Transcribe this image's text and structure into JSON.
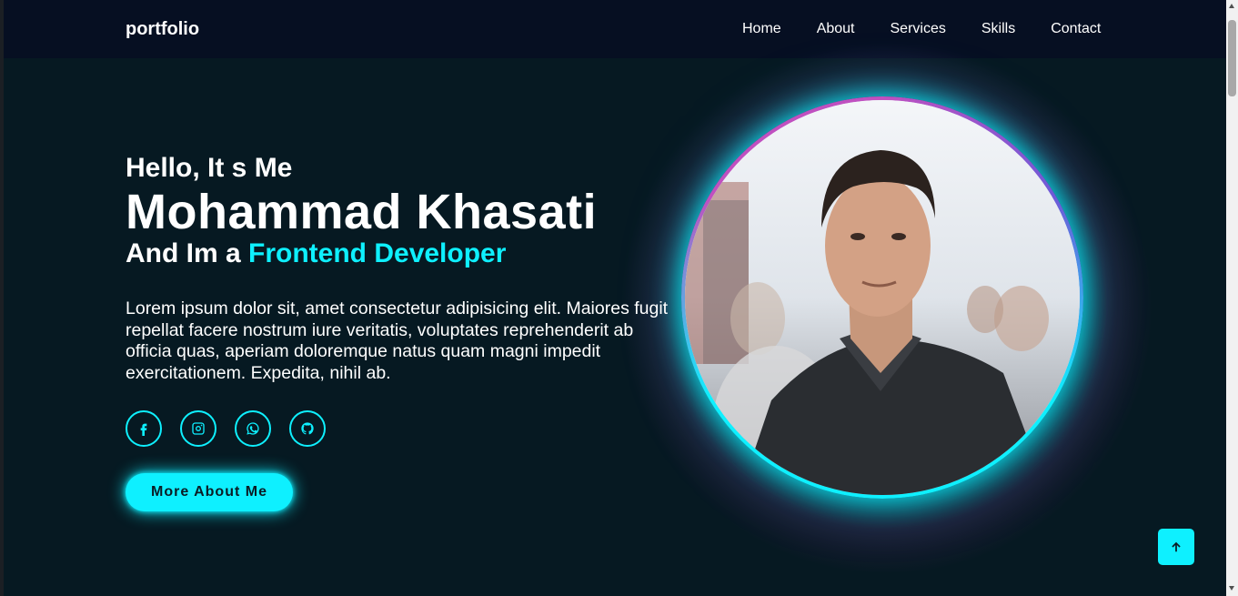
{
  "nav": {
    "logo": "portfolio",
    "links": [
      "Home",
      "About",
      "Services",
      "Skills",
      "Contact"
    ]
  },
  "hero": {
    "greeting": "Hello, It s Me",
    "name": "Mohammad Khasati",
    "role_prefix": "And Im a",
    "role_highlight": "Frontend Developer",
    "description": "Lorem ipsum dolor sit, amet consectetur adipisicing elit. Maiores fugit repellat facere nostrum iure veritatis, voluptates reprehenderit ab officia quas, aperiam doloremque natus quam magni impedit exercitationem. Expedita, nihil ab.",
    "socials": [
      "facebook-icon",
      "instagram-icon",
      "whatsapp-icon",
      "github-icon"
    ],
    "button_label": "More About Me"
  },
  "colors": {
    "accent": "#0ef0ff",
    "background": "#061922",
    "navbar": "#060f22"
  }
}
